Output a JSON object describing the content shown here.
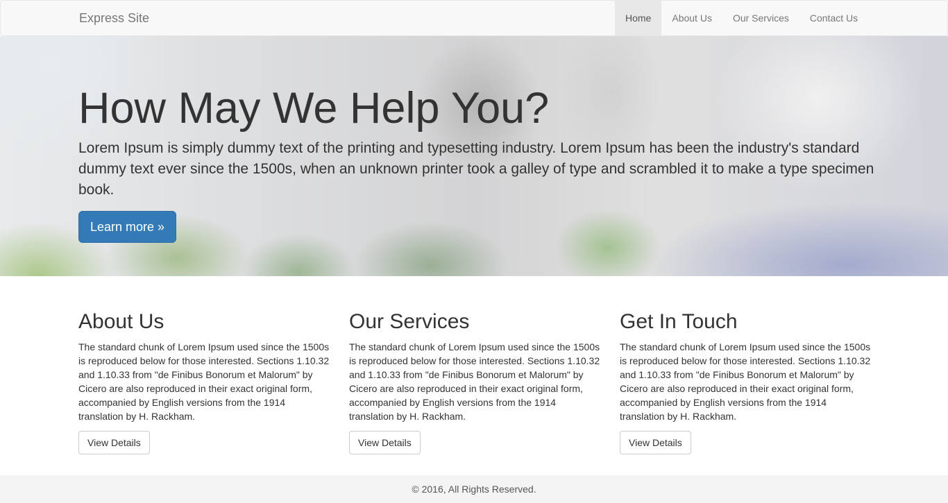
{
  "navbar": {
    "brand": "Express Site",
    "items": [
      {
        "label": "Home",
        "active": true
      },
      {
        "label": "About Us",
        "active": false
      },
      {
        "label": "Our Services",
        "active": false
      },
      {
        "label": "Contact Us",
        "active": false
      }
    ]
  },
  "hero": {
    "title": "How May We Help You?",
    "text": "Lorem Ipsum is simply dummy text of the printing and typesetting industry. Lorem Ipsum has been the industry's standard dummy text ever since the 1500s, when an unknown printer took a galley of type and scrambled it to make a type specimen book.",
    "button_label": "Learn more »",
    "accent_color": "#337ab7"
  },
  "features": [
    {
      "title": "About Us",
      "text": "The standard chunk of Lorem Ipsum used since the 1500s is reproduced below for those interested. Sections 1.10.32 and 1.10.33 from \"de Finibus Bonorum et Malorum\" by Cicero are also reproduced in their exact original form, accompanied by English versions from the 1914 translation by H. Rackham.",
      "button_label": "View Details"
    },
    {
      "title": "Our Services",
      "text": "The standard chunk of Lorem Ipsum used since the 1500s is reproduced below for those interested. Sections 1.10.32 and 1.10.33 from \"de Finibus Bonorum et Malorum\" by Cicero are also reproduced in their exact original form, accompanied by English versions from the 1914 translation by H. Rackham.",
      "button_label": "View Details"
    },
    {
      "title": "Get In Touch",
      "text": "The standard chunk of Lorem Ipsum used since the 1500s is reproduced below for those interested. Sections 1.10.32 and 1.10.33 from \"de Finibus Bonorum et Malorum\" by Cicero are also reproduced in their exact original form, accompanied by English versions from the 1914 translation by H. Rackham.",
      "button_label": "View Details"
    }
  ],
  "footer": {
    "text": "© 2016, All Rights Reserved."
  }
}
